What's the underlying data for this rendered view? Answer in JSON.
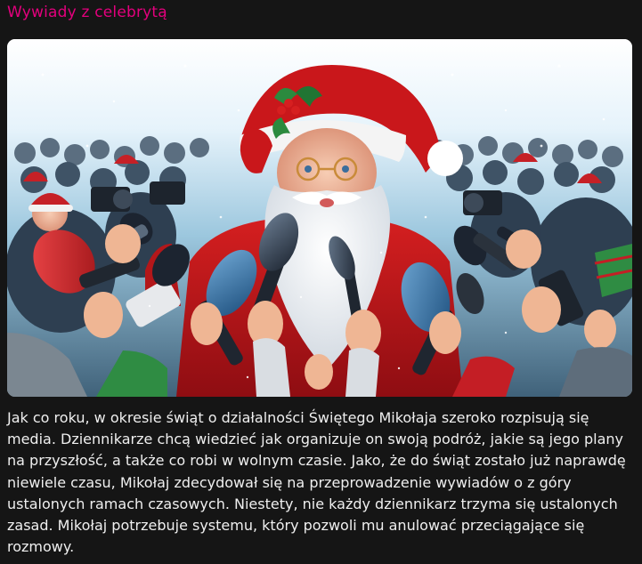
{
  "header": {
    "title": "Wywiady z celebrytą",
    "accent_color": "#e3007d"
  },
  "illustration": {
    "subject": "santa-press-conference-illustration"
  },
  "article": {
    "body": "Jak co roku, w okresie świąt o działalności Świętego Mikołaja szeroko rozpisują się media. Dziennikarze chcą wiedzieć jak organizuje on swoją podróż, jakie są jego plany na przyszłość, a także co robi w wolnym czasie. Jako, że do świąt zostało już naprawdę niewiele czasu, Mikołaj zdecydował się na przeprowadzenie wywiadów o z góry ustalonych ramach czasowych. Niestety, nie każdy dziennikarz trzyma się ustalonych zasad. Mikołaj potrzebuje systemu, który pozwoli mu anulować przeciągające się rozmowy."
  }
}
